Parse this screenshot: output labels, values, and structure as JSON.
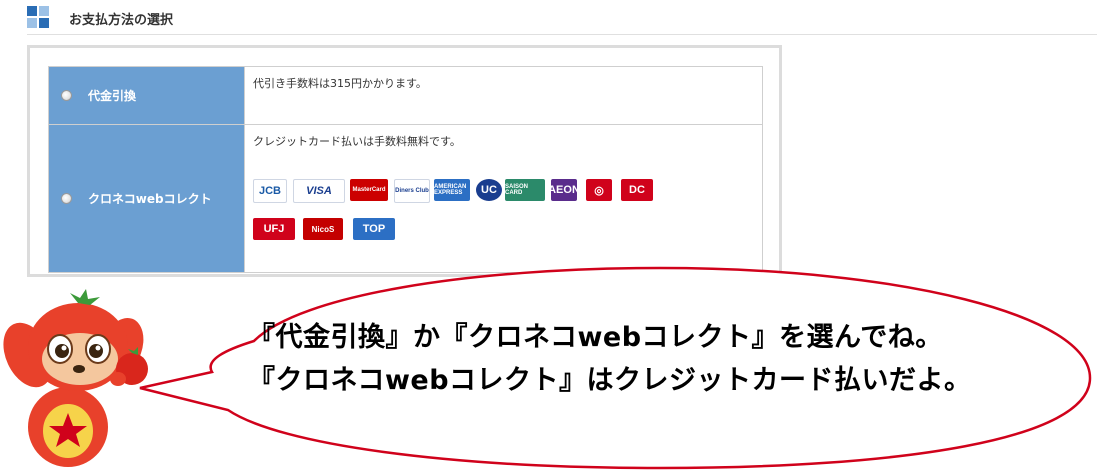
{
  "section": {
    "title": "お支払方法の選択"
  },
  "payment_options": [
    {
      "label": "代金引換",
      "description": "代引き手数料は315円かかります。"
    },
    {
      "label": "クロネコwebコレクト",
      "description": "クレジットカード払いは手数料無料です。"
    }
  ],
  "cards": [
    {
      "name": "jcb-logo",
      "text": "JCB",
      "bg": "#ffffff",
      "fg": "#1a5aa6"
    },
    {
      "name": "visa-logo",
      "text": "VISA",
      "bg": "#ffffff",
      "fg": "#1a3e8f"
    },
    {
      "name": "mastercard-logo",
      "text": "MasterCard",
      "bg": "#cc0000",
      "fg": "#ffffff"
    },
    {
      "name": "diners-club-logo",
      "text": "Diners Club",
      "bg": "#ffffff",
      "fg": "#1a3e8f"
    },
    {
      "name": "american-express-logo",
      "text": "AMERICAN EXPRESS",
      "bg": "#2c6fc4",
      "fg": "#ffffff"
    },
    {
      "name": "uc-logo",
      "text": "UC",
      "bg": "#1a3e8f",
      "fg": "#ffffff"
    },
    {
      "name": "saison-card-logo",
      "text": "SAISON CARD",
      "bg": "#2b8a6a",
      "fg": "#ffffff"
    },
    {
      "name": "aeon-logo",
      "text": "AEON",
      "bg": "#5a2c8c",
      "fg": "#ffffff"
    },
    {
      "name": "orico-logo",
      "text": "◎",
      "bg": "#d0021b",
      "fg": "#ffffff"
    },
    {
      "name": "dc-logo",
      "text": "DC",
      "bg": "#d0021b",
      "fg": "#ffffff"
    },
    {
      "name": "ufj-card-logo",
      "text": "UFJ",
      "bg": "#d0021b",
      "fg": "#ffffff"
    },
    {
      "name": "nicos-logo",
      "text": "NicoS",
      "bg": "#c40000",
      "fg": "#ffffff"
    },
    {
      "name": "tokyu-top-logo",
      "text": "TOP",
      "bg": "#2c6fc4",
      "fg": "#ffffff"
    }
  ],
  "speech": {
    "line1": "『代金引換』か『クロネコwebコレクト』を選んでね。",
    "line2": "『クロネコwebコレクト』はクレジットカード払いだよ。"
  },
  "colors": {
    "label_bg": "#6b9fd2",
    "bubble_stroke": "#d0021b",
    "mascot_red": "#e8412b"
  }
}
